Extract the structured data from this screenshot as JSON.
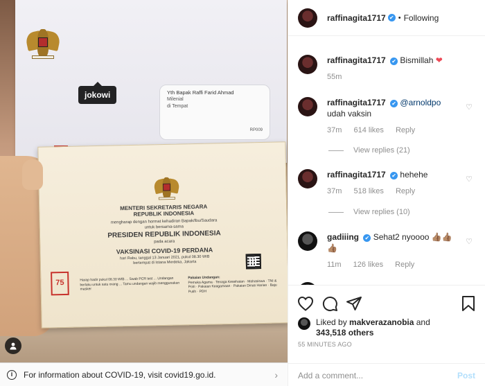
{
  "photo": {
    "tag_label": "jokowi",
    "envelope": {
      "addressee": "Yth Bapak Raffi Farid Ahmad",
      "line2": "Milenial",
      "line3": "di Tempat",
      "code": "RP009"
    },
    "card": {
      "issuer_line1": "MENTERI SEKRETARIS NEGARA",
      "issuer_line2": "REPUBLIK INDONESIA",
      "intro_line1": "mengharap dengan hormat kehadiran Bapak/Ibu/Saudara",
      "intro_line2": "untuk bersama-sama",
      "host": "PRESIDEN REPUBLIK INDONESIA",
      "pada_acara": "pada acara",
      "event": "VAKSINASI COVID-19 PERDANA",
      "date_line": "hari Rabu, tanggal 13 Januari 2021, pukul 08.30 WIB",
      "place_line": "bertempat di Istana Merdeka, Jakarta",
      "notes": "Harap hadir pukul 08.30 WIB ... Swab PCR test ... Undangan berlaku untuk satu orang ... Tamu undangan wajib menggunakan masker",
      "attire_title": "Pakaian Undangan:",
      "attire": "Pemuka Agama · Tenaga Kesehatan · Mahasiswa · TNI & Polri · Pakaian Keagamaan · Pakaian Dinas Harian · Baju Putih · PDH",
      "logo_text": "75"
    }
  },
  "covid_banner": {
    "info_icon": "i",
    "text": "For information about COVID-19, visit covid19.go.id.",
    "chevron": "›"
  },
  "header": {
    "username": "raffinagita1717",
    "verified_mark": "✔",
    "separator": "•",
    "follow_status": "Following"
  },
  "comments": [
    {
      "username": "raffinagita1717",
      "verified_mark": "✔",
      "text": "Bismillah ",
      "emoji": "❤",
      "time": "55m",
      "likes": "",
      "reply": ""
    },
    {
      "username": "raffinagita1717",
      "verified_mark": "✔",
      "mention": "@arnoldpo",
      "text": "udah vaksin",
      "time": "37m",
      "likes": "614 likes",
      "reply": "Reply",
      "view_replies": "View replies (21)"
    },
    {
      "username": "raffinagita1717",
      "verified_mark": "✔",
      "text": "hehehe",
      "time": "37m",
      "likes": "518 likes",
      "reply": "Reply",
      "view_replies": "View replies (10)"
    },
    {
      "username": "gadiiing",
      "verified_mark": "✔",
      "text": "Sehat2 nyoooo 👍🏽👍🏽",
      "text2": "👍🏽",
      "time": "11m",
      "likes": "126 likes",
      "reply": "Reply"
    }
  ],
  "actions": {
    "liked_by_prefix": "Liked by ",
    "liked_by_user": "makverazanobia",
    "liked_by_and": " and",
    "liked_by_count": "343,518 others",
    "timestamp": "55 MINUTES AGO"
  },
  "add_comment": {
    "placeholder": "Add a comment...",
    "post_label": "Post"
  },
  "colors": {
    "verified": "#3897f0",
    "heart_red": "#ed4956",
    "post_disabled": "#b2dffc",
    "muted": "#8e8e8e"
  },
  "icons": [
    "heart-icon",
    "comment-icon",
    "share-icon",
    "bookmark-icon",
    "user-tag-icon",
    "info-icon",
    "chevron-right-icon"
  ]
}
